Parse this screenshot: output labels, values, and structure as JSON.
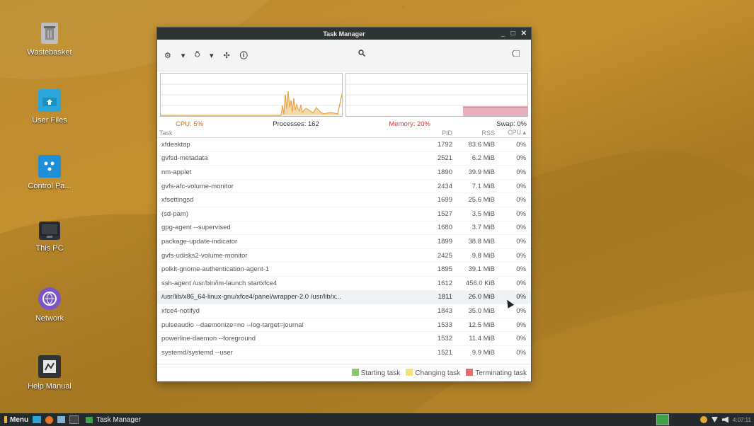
{
  "desktop": {
    "icons": [
      {
        "label": "Wastebasket",
        "icon": "trash-icon"
      },
      {
        "label": "User Files",
        "icon": "home-folder-icon"
      },
      {
        "label": "Control Pa...",
        "icon": "control-panel-icon"
      },
      {
        "label": "This PC",
        "icon": "computer-icon"
      },
      {
        "label": "Network",
        "icon": "network-icon"
      },
      {
        "label": "Help Manual",
        "icon": "help-manual-icon"
      }
    ]
  },
  "window": {
    "title": "Task Manager",
    "controls": {
      "minimize": "_",
      "maximize": "□",
      "close": "✕"
    },
    "toolbar": {
      "settings": "⚙",
      "settings_dropdown": "▾",
      "launch": "⍥",
      "launch_dropdown": "▾",
      "cross": "✣",
      "info": "ⓘ"
    },
    "search": {
      "value": "",
      "placeholder": "",
      "icon": "search-icon",
      "clear_icon": "clear-icon"
    },
    "stats": {
      "cpu": "CPU: 5%",
      "processes": "Processes: 162",
      "memory": "Memory: 20%",
      "swap": "Swap: 0%"
    },
    "columns": {
      "task": "Task",
      "pid": "PID",
      "rss": "RSS",
      "cpu": "CPU ▴"
    },
    "rows": [
      {
        "task": "xfdesktop",
        "pid": "1792",
        "rss": "83.6 MiB",
        "cpu": "0%"
      },
      {
        "task": "gvfsd-metadata",
        "pid": "2521",
        "rss": "6.2 MiB",
        "cpu": "0%"
      },
      {
        "task": "nm-applet",
        "pid": "1890",
        "rss": "39.9 MiB",
        "cpu": "0%"
      },
      {
        "task": "gvfs-afc-volume-monitor",
        "pid": "2434",
        "rss": "7.1 MiB",
        "cpu": "0%"
      },
      {
        "task": "xfsettingsd",
        "pid": "1699",
        "rss": "25.6 MiB",
        "cpu": "0%"
      },
      {
        "task": "(sd-pam)",
        "pid": "1527",
        "rss": "3.5 MiB",
        "cpu": "0%"
      },
      {
        "task": "gpg-agent --supervised",
        "pid": "1680",
        "rss": "3.7 MiB",
        "cpu": "0%"
      },
      {
        "task": "package-update-indicator",
        "pid": "1899",
        "rss": "38.8 MiB",
        "cpu": "0%"
      },
      {
        "task": "gvfs-udisks2-volume-monitor",
        "pid": "2425",
        "rss": "9.8 MiB",
        "cpu": "0%"
      },
      {
        "task": "polkit-gnome-authentication-agent-1",
        "pid": "1895",
        "rss": "39.1 MiB",
        "cpu": "0%"
      },
      {
        "task": "ssh-agent /usr/bin/im-launch startxfce4",
        "pid": "1612",
        "rss": "456.0 KiB",
        "cpu": "0%"
      },
      {
        "task": "/usr/lib/x86_64-linux-gnu/xfce4/panel/wrapper-2.0 /usr/lib/x...",
        "pid": "1811",
        "rss": "26.0 MiB",
        "cpu": "0%"
      },
      {
        "task": "xfce4-notifyd",
        "pid": "1843",
        "rss": "35.0 MiB",
        "cpu": "0%"
      },
      {
        "task": "pulseaudio --daemonize=no --log-target=journal",
        "pid": "1533",
        "rss": "12.5 MiB",
        "cpu": "0%"
      },
      {
        "task": "powerline-daemon --foreground",
        "pid": "1532",
        "rss": "11.4 MiB",
        "cpu": "0%"
      },
      {
        "task": "systemd/systemd --user",
        "pid": "1521",
        "rss": "9.9 MiB",
        "cpu": "0%"
      }
    ],
    "legend": {
      "starting": "Starting task",
      "changing": "Changing task",
      "terminating": "Terminating task"
    },
    "colors": {
      "cpu": "#e06c1f",
      "memory": "#d93a3a",
      "starting": "#8cc66b",
      "changing": "#f3e27a",
      "terminating": "#e46c6c",
      "memory_fill": "#e8aebc"
    }
  },
  "taskbar": {
    "menu": "Menu",
    "task": "Task Manager",
    "clock": "4:07:11"
  }
}
